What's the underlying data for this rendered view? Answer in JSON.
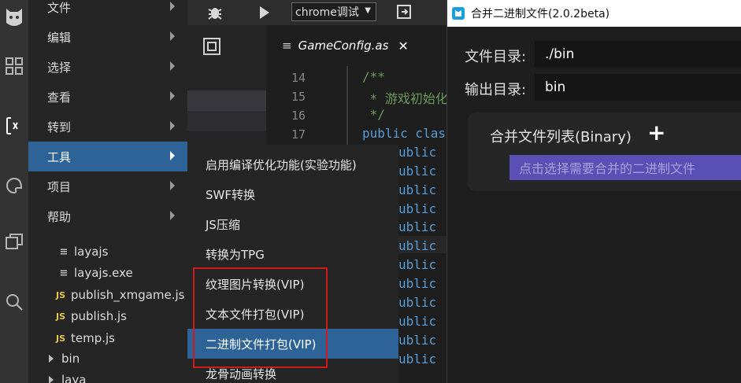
{
  "colors": {
    "menu_active_bg": "#2d6396",
    "highlight_box": "#d11b1b",
    "drop_zone_bg": "#5a4fb5",
    "dialog_bg": "#1e1e1e"
  },
  "toolbar": {
    "debug_icon": "bug-icon",
    "run_icon": "play-icon",
    "target_select": "chrome调试",
    "export_icon": "export-icon"
  },
  "editor": {
    "tab_label": "GameConfig.as",
    "line_numbers": [
      "14",
      "15",
      "16",
      "17"
    ],
    "code_lines": [
      "/**",
      " * 游戏初始化",
      " */",
      "public clas"
    ],
    "keyword_fragment": "ublic"
  },
  "menu": {
    "items": [
      {
        "label": "文件"
      },
      {
        "label": "编辑"
      },
      {
        "label": "选择"
      },
      {
        "label": "查看"
      },
      {
        "label": "转到"
      },
      {
        "label": "工具"
      },
      {
        "label": "项目"
      },
      {
        "label": "帮助"
      }
    ]
  },
  "submenu": {
    "items": [
      {
        "label": "启用编译优化功能(实验功能)"
      },
      {
        "label": "SWF转换"
      },
      {
        "label": "JS压缩"
      },
      {
        "label": "转换为TPG"
      },
      {
        "label": "纹理图片转换(VIP)"
      },
      {
        "label": "文本文件打包(VIP)"
      },
      {
        "label": "二进制文件打包(VIP)"
      },
      {
        "label": "龙骨动画转换"
      }
    ]
  },
  "tree": {
    "items": [
      {
        "label": "layajs"
      },
      {
        "label": "layajs.exe"
      },
      {
        "label": "publish_xmgame.js"
      },
      {
        "label": "publish.js"
      },
      {
        "label": "temp.js"
      },
      {
        "label": "bin"
      },
      {
        "label": "laya"
      }
    ]
  },
  "dialog": {
    "title": "合并二进制文件(2.0.2beta)",
    "dir_label": "文件目录:",
    "dir_value": "./bin",
    "out_label": "输出目录:",
    "out_value": "bin",
    "merge_title": "合并文件列表(Binary)",
    "add_symbol": "+",
    "drop_text": "点击选择需要合并的二进制文件"
  }
}
